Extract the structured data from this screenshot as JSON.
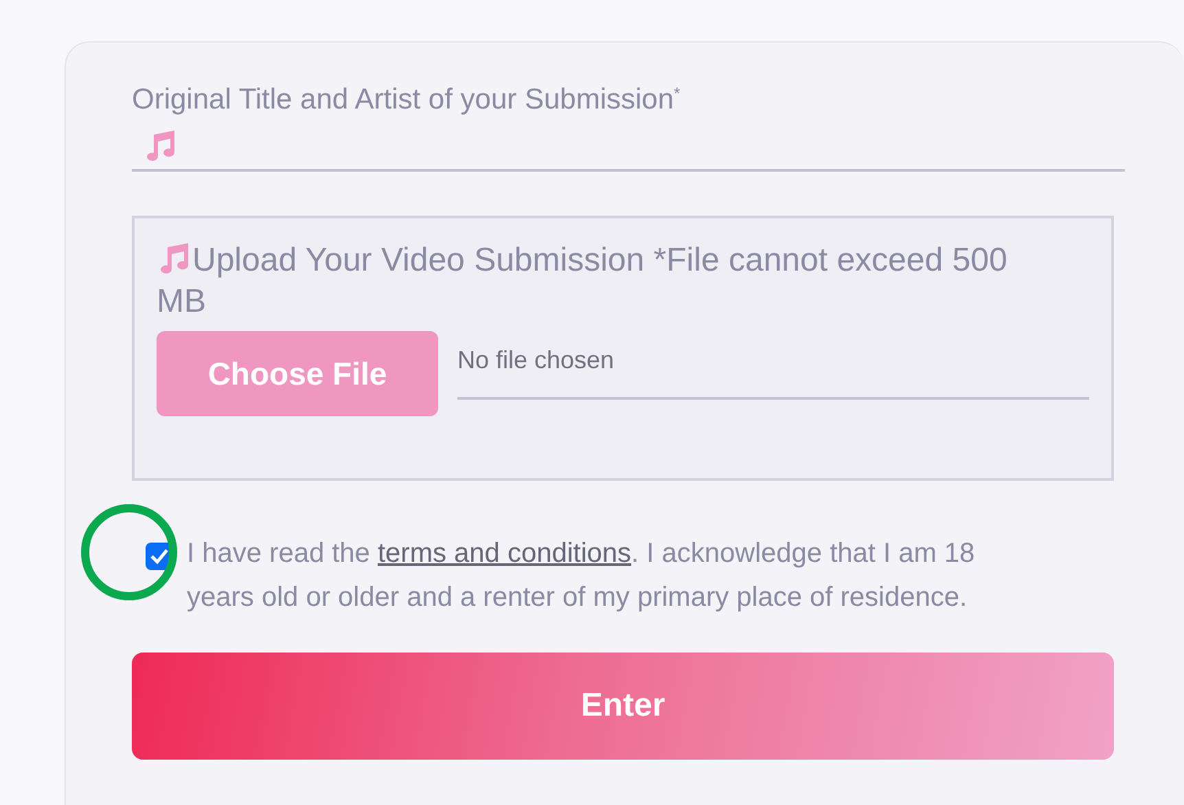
{
  "title_field": {
    "label": "Original Title and Artist of your Submission",
    "required_mark": "*"
  },
  "upload": {
    "label": "Upload Your Video Submission",
    "note": "*File cannot exceed 500 MB",
    "button": "Choose File",
    "file_status": "No file chosen"
  },
  "agreement": {
    "checked": true,
    "text_before": "I have read the ",
    "link": "terms and conditions",
    "text_after": ". I acknowledge that I am 18 years old or older and a renter of my primary place of residence.",
    "highlighted": true
  },
  "submit_button": "Enter"
}
